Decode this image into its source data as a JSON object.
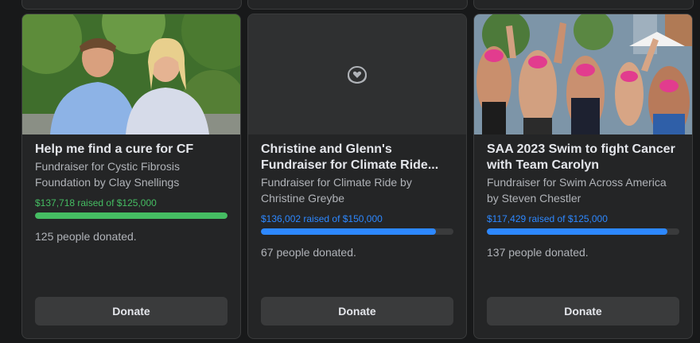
{
  "cards": [
    {
      "title": "Help me find a cure for CF",
      "subtitle": "Fundraiser for Cystic Fibrosis Foundation by Clay Snellings",
      "raised": "$137,718 raised of $125,000",
      "progress": 1.0,
      "progress_color": "#45bd62",
      "donated": "125 people donated.",
      "donate_label": "Donate"
    },
    {
      "title": "Christine and Glenn's Fundraiser for Climate Ride...",
      "subtitle": "Fundraiser for Climate Ride by Christine Greybe",
      "raised": "$136,002 raised of $150,000",
      "progress": 0.91,
      "progress_color": "#2d88ff",
      "placeholder_icon": "heart-coin-icon",
      "donated": "67 people donated.",
      "donate_label": "Donate"
    },
    {
      "title": "SAA 2023 Swim to fight Cancer with Team Carolyn",
      "subtitle": "Fundraiser for Swim Across America by Steven Chestler",
      "raised": "$117,429 raised of $125,000",
      "progress": 0.94,
      "progress_color": "#2d88ff",
      "donated": "137 people donated.",
      "donate_label": "Donate"
    }
  ]
}
